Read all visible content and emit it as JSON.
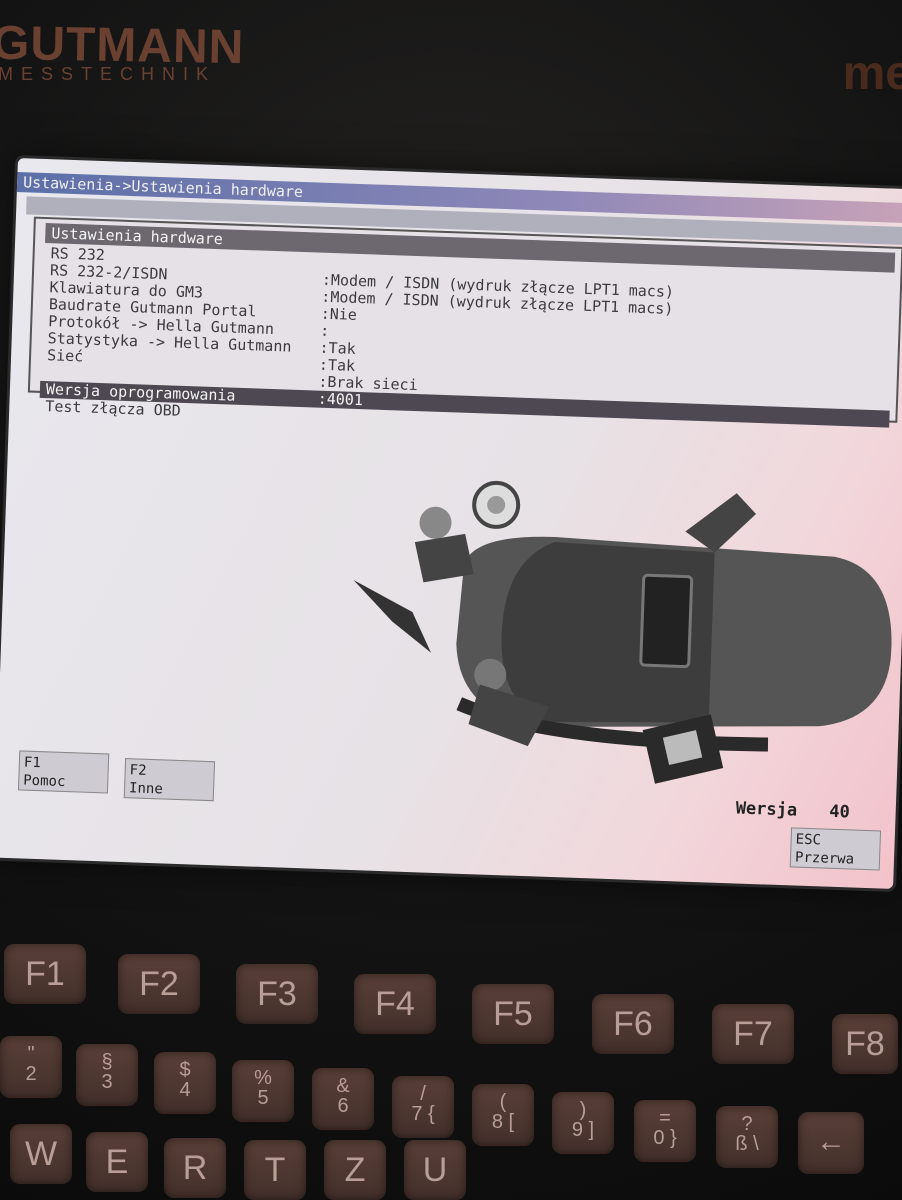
{
  "brand": {
    "name": "GUTMANN",
    "subtitle": "MESSTECHNIK",
    "right_partial": "me"
  },
  "window": {
    "title": "Ustawienia->Ustawienia hardware"
  },
  "menu": {
    "header": "Ustawienia hardware",
    "rows": [
      {
        "label": "RS 232",
        "value": ""
      },
      {
        "label": "RS 232-2/ISDN",
        "value": ":Modem / ISDN (wydruk złącze LPT1 macs)"
      },
      {
        "label": "Klawiatura do GM3",
        "value": ":Modem / ISDN (wydruk złącze LPT1 macs)"
      },
      {
        "label": "Baudrate Gutmann Portal",
        "value": ":Nie"
      },
      {
        "label": "Protokół -> Hella Gutmann",
        "value": ":"
      },
      {
        "label": "Statystyka -> Hella Gutmann",
        "value": ":Tak"
      },
      {
        "label": "Sieć",
        "value": ":Tak"
      },
      {
        "label": "",
        "value": ":Brak sieci"
      },
      {
        "label": "Wersja oprogramowania",
        "value": ":4001"
      },
      {
        "label": "Test złącza OBD",
        "value": ""
      }
    ],
    "selected_index": 8
  },
  "function_keys": {
    "f1": {
      "key": "F1",
      "label": "Pomoc"
    },
    "f2": {
      "key": "F2",
      "label": "Inne"
    },
    "esc": {
      "key": "ESC",
      "label": "Przerwa"
    }
  },
  "status": {
    "version_label": "Wersja",
    "version_value": "40"
  },
  "keyboard": {
    "fkeys": [
      "F1",
      "F2",
      "F3",
      "F4",
      "F5",
      "F6",
      "F7",
      "F8"
    ],
    "row2": [
      {
        "top": "\"",
        "bottom": "2"
      },
      {
        "top": "§",
        "bottom": "3"
      },
      {
        "top": "$",
        "bottom": "4"
      },
      {
        "top": "%",
        "bottom": "5"
      },
      {
        "top": "&",
        "bottom": "6"
      },
      {
        "top": "/",
        "bottom": "7 {"
      },
      {
        "top": "(",
        "bottom": "8 ["
      },
      {
        "top": ")",
        "bottom": "9 ]"
      },
      {
        "top": "=",
        "bottom": "0 }"
      },
      {
        "top": "?",
        "bottom": "ß \\"
      },
      {
        "top": "",
        "bottom": "←"
      }
    ],
    "letters": [
      "W",
      "E",
      "R",
      "T",
      "Z",
      "U"
    ]
  },
  "colors": {
    "screen_bg": "#e8e8ee",
    "highlight": "#4d4852",
    "title_bar": "#5c6fa8"
  }
}
